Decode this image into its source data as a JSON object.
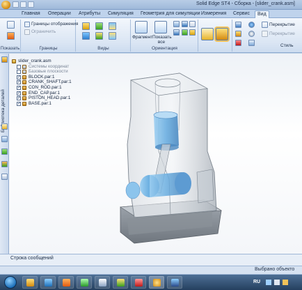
{
  "window": {
    "title": "Solid Edge ST4 - Сборка - [slider_crank.asm]"
  },
  "tabs": [
    {
      "label": "Главная"
    },
    {
      "label": "Операции"
    },
    {
      "label": "Атрибуты"
    },
    {
      "label": "Симуляция"
    },
    {
      "label": "Геометрия для симуляции"
    },
    {
      "label": "Измерения"
    },
    {
      "label": "Сервис"
    },
    {
      "label": "Вид"
    }
  ],
  "ribbon": {
    "show_group": {
      "label": "Показать"
    },
    "bounds_group": {
      "label": "Границы",
      "display_bounds": "Границы отображения",
      "limit": "Ограничить"
    },
    "views_group": {
      "label": "Виды"
    },
    "orientation_group": {
      "label": "Ориентация",
      "fragment": "Фрагмент",
      "show_all": "Показать все"
    },
    "style_group": {
      "label": "Стиль",
      "overlap1": "Перекрытие",
      "overlap2": "Перекрытие"
    }
  },
  "left_panel": {
    "library_label": "Библиотека деталей"
  },
  "tree": {
    "root": "slider_crank.asm",
    "items": [
      {
        "label": "Системы координат",
        "checked": false,
        "dim": true
      },
      {
        "label": "Базовые плоскости",
        "checked": false,
        "dim": true
      },
      {
        "label": "BLOCK.par:1",
        "checked": true,
        "dim": false
      },
      {
        "label": "CRANK_SHAFT.par:1",
        "checked": true,
        "dim": false
      },
      {
        "label": "CON_ROD.par:1",
        "checked": true,
        "dim": false
      },
      {
        "label": "END_CAP.par:1",
        "checked": true,
        "dim": false
      },
      {
        "label": "PISTON_HEAD.par:1",
        "checked": true,
        "dim": false
      },
      {
        "label": "BASE.par:1",
        "checked": true,
        "dim": false
      }
    ]
  },
  "message_bar": {
    "title": "Строка сообщений"
  },
  "status_bar": {
    "text": "Выбрано объекто"
  },
  "taskbar": {
    "language": "RU"
  },
  "colors": {
    "ribbon_bg": "#dbe6f4",
    "part_blue": "#6aaee0",
    "housing_gray": "#b8c0c8"
  }
}
